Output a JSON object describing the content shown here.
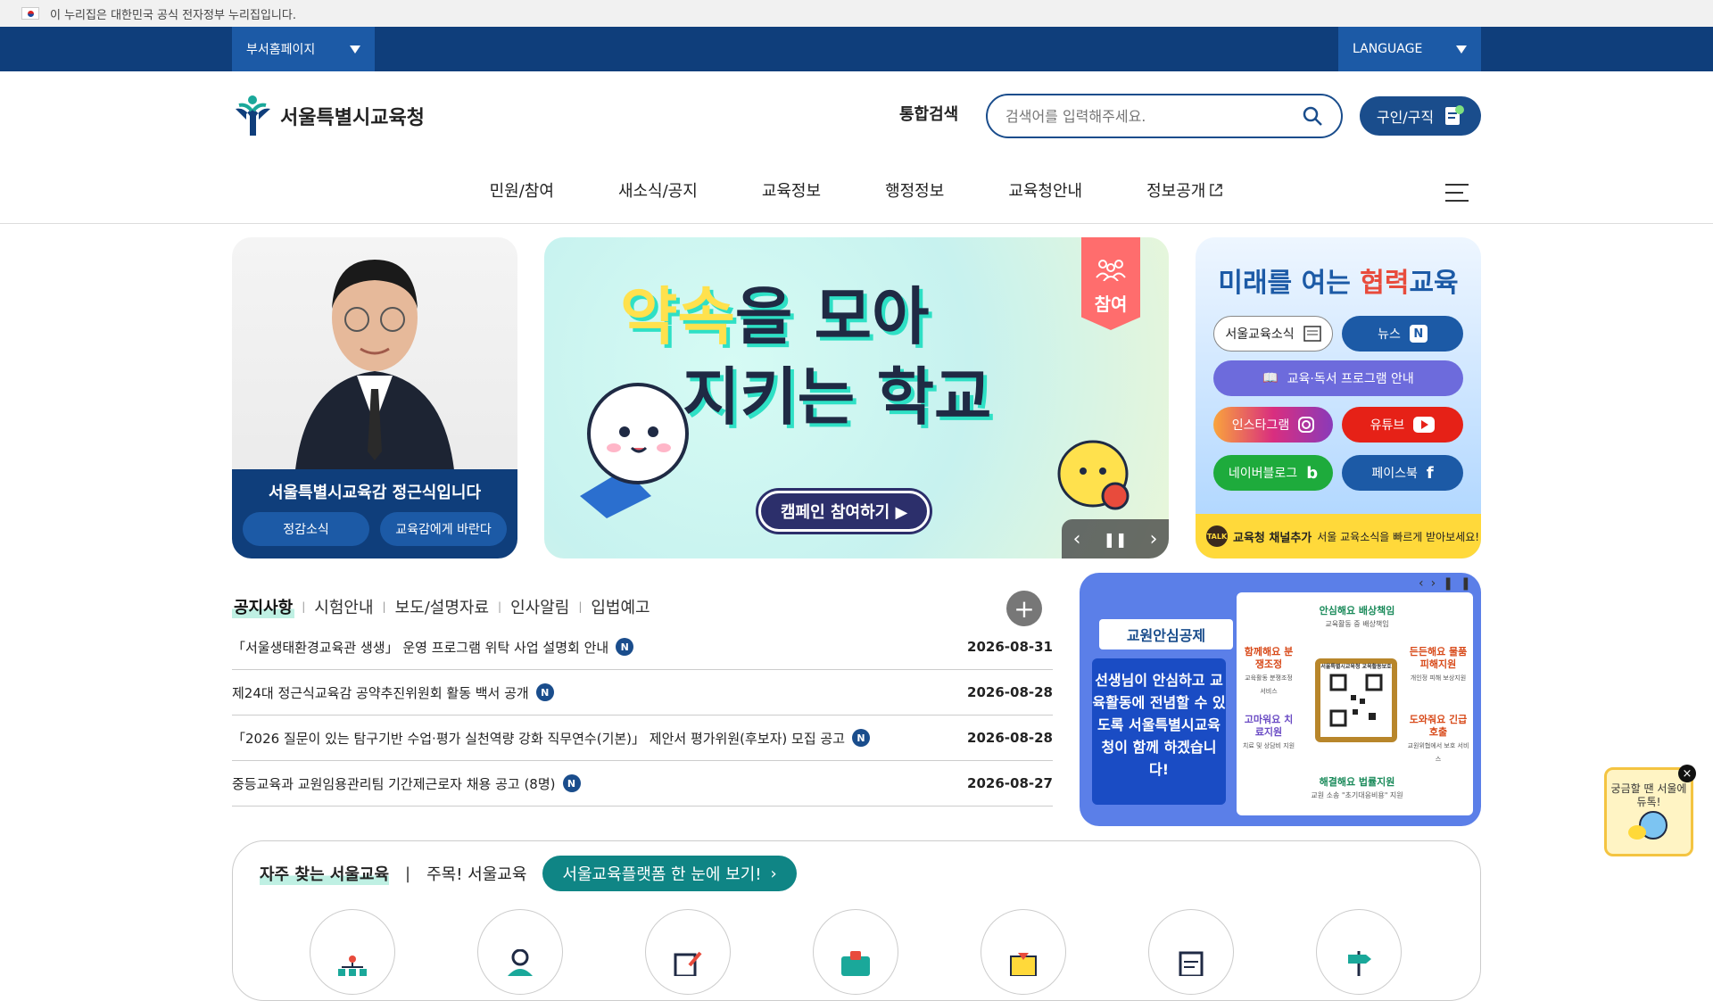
{
  "gov_banner": {
    "text": "이 누리집은 대한민국 공식 전자정부 누리집입니다."
  },
  "top_nav": {
    "dept_label": "부서홈페이지",
    "language_label": "LANGUAGE"
  },
  "header": {
    "logo_text": "서울특별시교육청",
    "search_label": "통합검색",
    "search_placeholder": "검색어를 입력해주세요.",
    "job_button": "구인/구직"
  },
  "gnb": {
    "items": [
      "민원/참여",
      "새소식/공지",
      "교육정보",
      "행정정보",
      "교육청안내",
      "정보공개"
    ]
  },
  "profile": {
    "title": "서울특별시교육감 정근식입니다",
    "btn_news": "정감소식",
    "btn_wish": "교육감에게 바란다"
  },
  "banner": {
    "tag": "참여",
    "title_line1_a": "약속",
    "title_line1_b": "을 모아",
    "title_line2": "지키는 학교",
    "cta": "캠페인 참여하기 ▶"
  },
  "channels": {
    "title_a": "미래를 여는 ",
    "title_b": "협력",
    "title_c": "교육",
    "btn_news_letter": "서울교육소식",
    "btn_news": "뉴스",
    "btn_reading": "교육·독서 프로그램 안내",
    "btn_instagram": "인스타그램",
    "btn_youtube": "유튜브",
    "btn_blog": "네이버블로그",
    "btn_facebook": "페이스북",
    "footer_bold": "교육청 채널추가",
    "footer_text": "서울 교육소식을 빠르게 받아보세요!",
    "talk_label": "TALK"
  },
  "notices": {
    "tabs": [
      "공지사항",
      "시험안내",
      "보도/설명자료",
      "인사알림",
      "입법예고"
    ],
    "items": [
      {
        "title": "「서울생태환경교육관 생생」 운영 프로그램 위탁 사업 설명회 안내",
        "date": "2026-08-31",
        "badge": "N"
      },
      {
        "title": "제24대 정근식교육감 공약추진위원회 활동 백서 공개",
        "date": "2026-08-28",
        "badge": "N"
      },
      {
        "title": "「2026 질문이 있는 탐구기반 수업·평가 실천역량 강화 직무연수(기본)」 제안서 평가위원(후보자) 모집 공고",
        "date": "2026-08-28",
        "badge": "N"
      },
      {
        "title": "중등교육과 교원임용관리팀 기간제근로자 채용 공고 (8명)",
        "date": "2026-08-27",
        "badge": "N"
      }
    ]
  },
  "promo": {
    "badge": "교원안심공제",
    "text": "선생님이 안심하고 교육활동에 전념할 수 있도록 서울특별시교육청이 함께 하겠습니다!",
    "labels": {
      "top": "안심해요 배상책임",
      "top_sub": "교육활동 중 배상책임",
      "left1": "함께해요 분쟁조정",
      "left1_sub": "교육활동 분쟁조정 서비스",
      "right1": "든든해요 물품피해지원",
      "right1_sub": "개인정 피해 보상지원",
      "left2": "고마워요 치료지원",
      "left2_sub": "치료 및 상담비 지원",
      "right2": "도와줘요 긴급호출",
      "right2_sub": "교원위협에서 보호 서비스",
      "bottom": "해결해요 법률지원",
      "bottom_sub": "교원 소송 \"초기대응비용\" 지원",
      "center": "서울특별시교육청 교육활동보호"
    }
  },
  "favorites": {
    "tab_active": "자주 찾는 서울교육",
    "tab_other": "주목! 서울교육",
    "cta": "서울교육플랫폼 한 눈에 보기!"
  },
  "float_widget": {
    "text": "궁금할 땐 서울에듀톡!",
    "close": "×"
  }
}
